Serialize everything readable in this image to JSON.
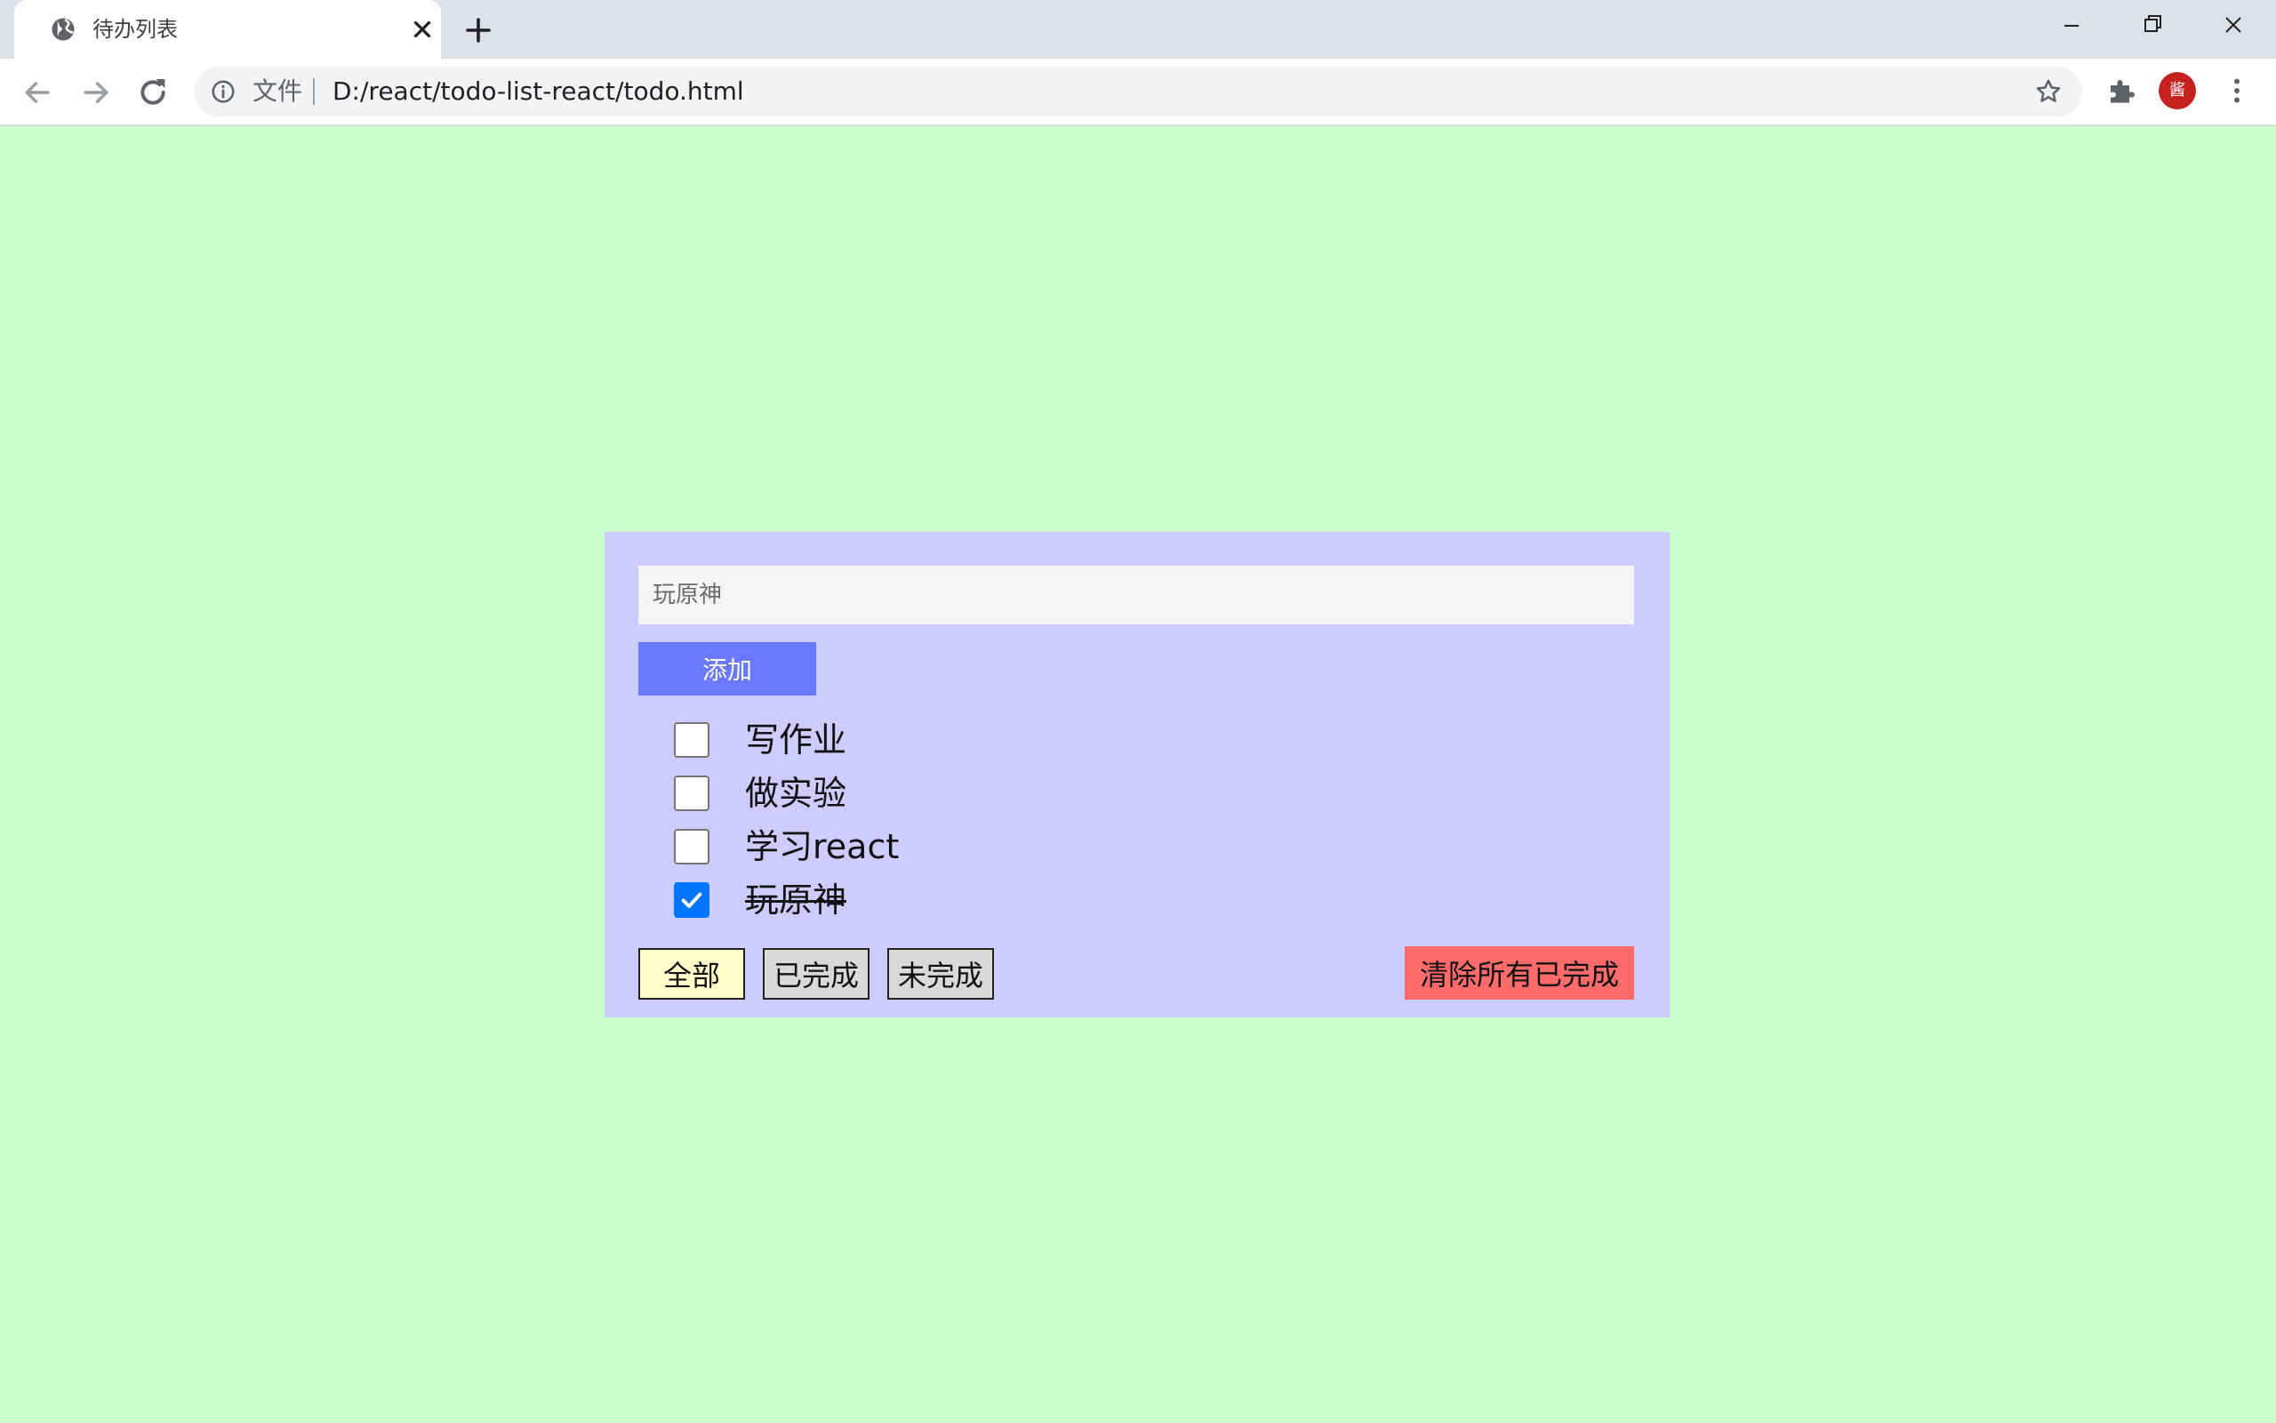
{
  "browser": {
    "tab": {
      "title": "待办列表",
      "favicon": "globe-icon",
      "close_icon": "close-icon"
    },
    "new_tab_icon": "plus-icon",
    "window_controls": [
      "minimize-icon",
      "restore-icon",
      "close-icon"
    ],
    "toolbar": {
      "back_icon": "arrow-left-icon",
      "forward_icon": "arrow-right-icon",
      "reload_icon": "reload-icon",
      "address": {
        "security_icon": "info-icon",
        "scheme_label": "文件",
        "url": "D:/react/todo-list-react/todo.html"
      },
      "bookmark_icon": "star-icon",
      "extensions_icon": "puzzle-icon",
      "profile_initial": "酱",
      "menu_icon": "more-vert-icon"
    }
  },
  "todo": {
    "input": {
      "value": "",
      "placeholder": "玩原神"
    },
    "add_label": "添加",
    "items": [
      {
        "text": "写作业",
        "done": false
      },
      {
        "text": "做实验",
        "done": false
      },
      {
        "text": "学习react",
        "done": false
      },
      {
        "text": "玩原神",
        "done": true
      }
    ],
    "filters": {
      "all": "全部",
      "done": "已完成",
      "undone": "未完成",
      "active": "all"
    },
    "clear_label": "清除所有已完成"
  },
  "colors": {
    "page_bg": "#ccffcc",
    "panel_bg": "#ccccff",
    "add_button": "#6b79ff",
    "active_filter": "#ffffcc",
    "inactive_filter": "#d9d9d9",
    "clear_button": "#ff6b6b",
    "checkbox_checked": "#0075ff"
  }
}
